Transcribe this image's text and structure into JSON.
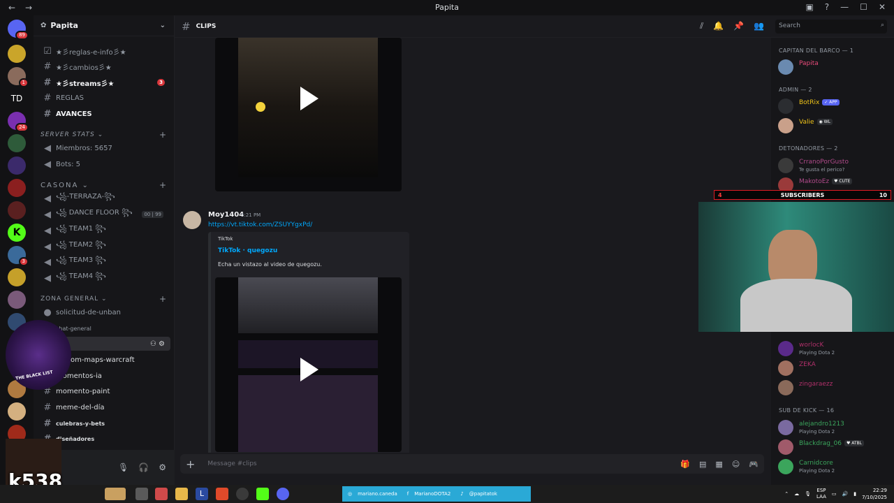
{
  "window": {
    "title": "Papita"
  },
  "server": {
    "name": "Papita"
  },
  "server_badges": [
    {
      "badge": "89"
    },
    {
      "badge": ""
    },
    {
      "badge": "1"
    },
    {
      "badge": "TD"
    },
    {
      "badge": "24"
    },
    {
      "badge": ""
    },
    {
      "badge": ""
    },
    {
      "badge": ""
    },
    {
      "badge": ""
    },
    {
      "badge": "K"
    },
    {
      "badge": "3"
    }
  ],
  "channels": {
    "items": [
      {
        "name": "★彡reglas-e-info彡★",
        "style": "normal"
      },
      {
        "name": "★彡cambios彡★",
        "style": "normal"
      },
      {
        "name": "★彡streams彡★",
        "style": "bold",
        "count": "3"
      },
      {
        "name": "REGLAS",
        "style": "normal"
      },
      {
        "name": "AVANCES",
        "style": "bold"
      }
    ],
    "cat_stats": "SERVER STATS",
    "stats": [
      "Miembros: 5657",
      "Bots: 5"
    ],
    "cat_casona": "CASONA",
    "voice": [
      "꧁-TERRAZA-꧂",
      "꧁ DANCE FLOOR ꧂",
      "꧁ TEAM1 ꧂",
      "꧁ TEAM2 ꧂",
      "꧁ TEAM3 ꧂",
      "꧁ TEAM4 ꧂"
    ],
    "dance_counts": [
      "00",
      "99"
    ],
    "cat_general": "ZONA GENERAL",
    "general": [
      "solicitud-de-unban",
      "chat-general",
      "",
      "custom-maps-warcraft",
      "momentos-ia",
      "momento-paint",
      "meme-del-día",
      "culebras-y-bets",
      "diseñadores"
    ]
  },
  "topbar": {
    "channel": "CLIPS",
    "search_placeholder": "Search"
  },
  "message": {
    "author": "Moy1404",
    "time": "5:21 PM",
    "link": "https://vt.tiktok.com/ZSUYYgxPd/",
    "embed_provider": "TikTok",
    "embed_title": "TikTok · quegozu",
    "embed_desc": "Echa un vistazo al video de quegozu."
  },
  "composer": {
    "placeholder": "Message #clips"
  },
  "members": {
    "groups": [
      {
        "label": "CAPITAN DEL BARCO — 1"
      },
      {
        "label": "ADMIN — 2"
      },
      {
        "label": "DETONADORES — 2"
      },
      {
        "label": "SUB DE KICK — 16"
      }
    ],
    "list": [
      {
        "name": "Papita",
        "color": "#e84b7a",
        "sub": ""
      },
      {
        "name": "BotRix",
        "color": "#f0c419",
        "sub": "",
        "tag": "✓ APP"
      },
      {
        "name": "Valie",
        "color": "#f0c419",
        "sub": "",
        "tag": "◉ WL"
      },
      {
        "name": "CrranoPorGusto",
        "color": "#b04a8a",
        "sub": "Te gusta el perico?"
      },
      {
        "name": "MakotoEz",
        "color": "#b04a8a",
        "sub": "",
        "tag": "♥ CUTE"
      },
      {
        "name": "worlocK",
        "color": "#b0306a",
        "sub": "Playing Dota 2"
      },
      {
        "name": "ZEKA",
        "color": "#b0306a",
        "sub": ""
      },
      {
        "name": "zingaraezz",
        "color": "#b0306a",
        "sub": ""
      },
      {
        "name": "alejandro1213",
        "color": "#3ba55c",
        "sub": "Playing Dota 2"
      },
      {
        "name": "Blackdrag_06",
        "color": "#3ba55c",
        "sub": "",
        "tag": "♥ ATBL"
      },
      {
        "name": "Carnidcore",
        "color": "#3ba55c",
        "sub": "Playing Dota 2"
      }
    ]
  },
  "sub_goal": {
    "left": "4",
    "label": "SUBSCRIBERS",
    "right": "10"
  },
  "overlay": {
    "streamer_tag": "k538",
    "badge_text": "THE BLACK LIST"
  },
  "social_bar": {
    "items": [
      "mariano.caneda",
      "MarianoDOTA2",
      "@papitatok"
    ]
  },
  "tray": {
    "lang": "ESP",
    "lang2": "LAA",
    "time": "22:29",
    "date": "7/10/2025"
  }
}
